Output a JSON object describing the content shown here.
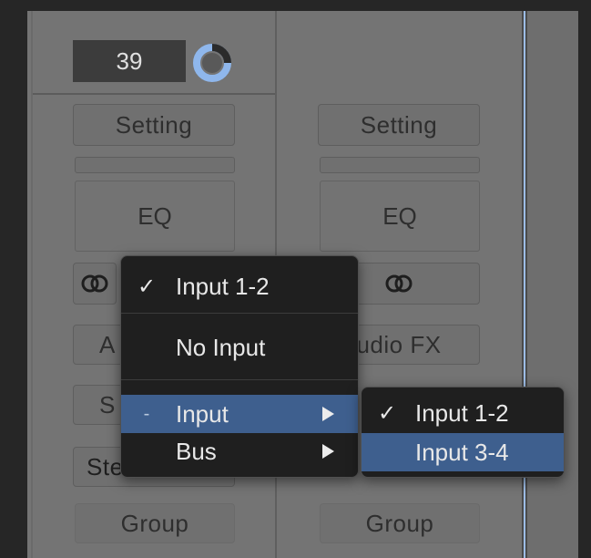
{
  "strip1": {
    "volume_value": "39",
    "setting_label": "Setting",
    "eq_label": "EQ",
    "audio_fx_partial": "A",
    "sends_partial": "S",
    "output_partial": "Stereo Out",
    "group_label": "Group"
  },
  "strip2": {
    "setting_label": "Setting",
    "eq_label": "EQ",
    "audio_fx_partial": "udio FX",
    "group_label": "Group"
  },
  "input_menu": {
    "items": [
      {
        "label": "Input 1-2",
        "check": "✓"
      },
      {
        "label": "No Input",
        "check": ""
      },
      {
        "label": "Input",
        "check": "-"
      },
      {
        "label": "Bus",
        "check": ""
      }
    ]
  },
  "input_submenu": {
    "items": [
      {
        "label": "Input 1-2",
        "check": "✓"
      },
      {
        "label": "Input 3-4",
        "check": ""
      }
    ]
  },
  "colors": {
    "menu_highlight": "#3e5f8e",
    "knob_accent": "#8fb7ec",
    "selection_line": "#9dbde6"
  }
}
